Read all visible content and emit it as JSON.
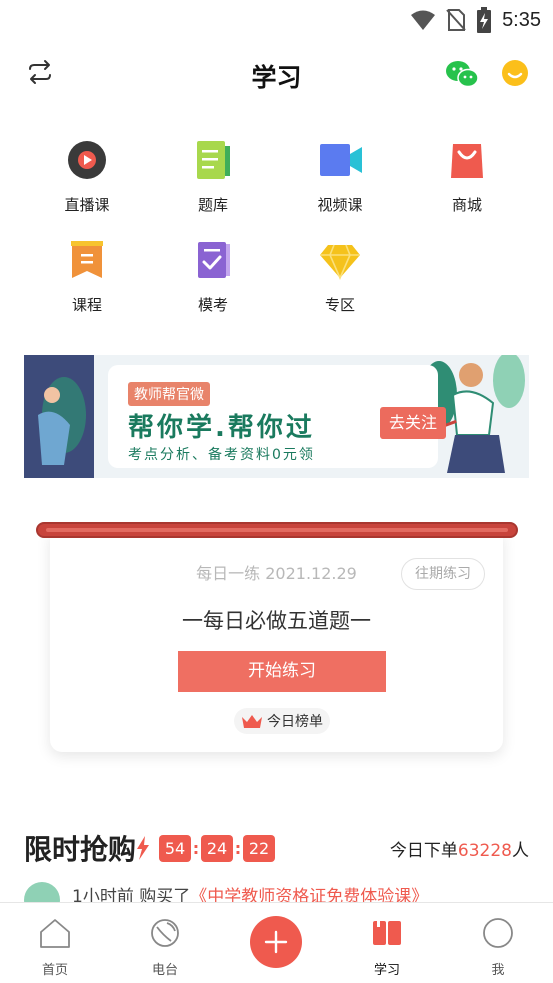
{
  "status_bar": {
    "time": "5:35",
    "icons": [
      "wifi-icon",
      "no-sim-icon",
      "battery-charging-icon"
    ]
  },
  "header": {
    "title": "学习",
    "left_icon": "switch-arrows-icon",
    "right_icons": [
      "wechat-icon",
      "chat-bubble-icon"
    ]
  },
  "categories": [
    {
      "label": "直播课",
      "icon": "live-play-icon",
      "color": "#e84c43"
    },
    {
      "label": "题库",
      "icon": "question-bank-icon",
      "color": "#8bc53f"
    },
    {
      "label": "视频课",
      "icon": "video-camera-icon",
      "color": "#5b7bf0"
    },
    {
      "label": "商城",
      "icon": "shopping-bag-icon",
      "color": "#ef5a4e"
    },
    {
      "label": "课程",
      "icon": "course-bookmark-icon",
      "color": "#f0923a"
    },
    {
      "label": "模考",
      "icon": "mock-exam-icon",
      "color": "#8a63d2"
    },
    {
      "label": "专区",
      "icon": "diamond-icon",
      "color": "#f5c21b"
    }
  ],
  "banner": {
    "tag": "教师帮官微",
    "main": "帮你学.帮你过",
    "sub": "考点分析、备考资料0元领",
    "button": "去关注"
  },
  "daily": {
    "date_label": "每日一练 2021.12.29",
    "past_button": "往期练习",
    "title": "一每日必做五道题一",
    "start_button": "开始练习",
    "rank_label": "今日榜单"
  },
  "flash_sale": {
    "title": "限时抢购",
    "countdown": [
      "54",
      "24",
      "22"
    ],
    "order_prefix": "今日下单",
    "order_count": "63228",
    "order_suffix": "人",
    "ticker_prefix": "1小时前 购买了",
    "ticker_course": "《中学教师资格证免费体验课》"
  },
  "tabbar": {
    "tabs": [
      {
        "label": "首页",
        "icon": "home-icon"
      },
      {
        "label": "电台",
        "icon": "radio-dish-icon"
      },
      {
        "label": "学习",
        "icon": "book-icon"
      },
      {
        "label": "我",
        "icon": "profile-circle-icon"
      }
    ],
    "active": "学习",
    "add_icon": "plus-icon"
  },
  "colors": {
    "accent": "#ef5a4e",
    "rank_crown": "#ef5a4e",
    "banner_text": "#1a7a5e"
  }
}
